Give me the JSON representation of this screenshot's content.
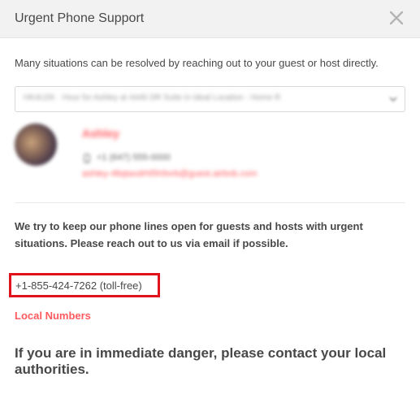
{
  "header": {
    "title": "Urgent Phone Support",
    "close_icon": "close-icon"
  },
  "intro": {
    "text": "Many situations can be resolved by reaching out to your guest or host directly."
  },
  "reservation_select": {
    "selected_value": "HK4U2K · Hour for Ashley at 4446 DR Suite in Ideal Location - Home R",
    "chevron_icon": "chevron-down-icon"
  },
  "contact": {
    "name": "Ashley",
    "phone": "+1 (647) 555-0000",
    "email": "ashley-4ltqtaxdrhl5h9xrb@guest.airbnb.com",
    "phone_icon": "phone-icon"
  },
  "support": {
    "description": "We try to keep our phone lines open for guests and hosts with urgent situations. Please reach out to us via email if possible.",
    "toll_free": "+1-855-424-7262 (toll-free)",
    "local_numbers_link": "Local Numbers",
    "danger_text": "If you are in immediate danger, please contact your local authorities."
  },
  "colors": {
    "accent": "#ff5a5f",
    "highlight_box": "#e0131c",
    "text": "#484848",
    "header_bg": "#f2f2f2"
  }
}
